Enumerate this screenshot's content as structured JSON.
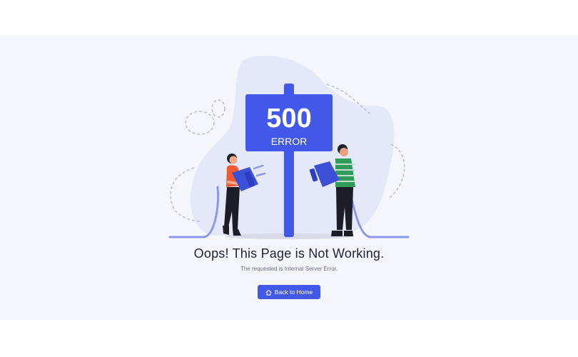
{
  "error_page": {
    "sign_code": "500",
    "sign_word": "ERROR",
    "title": "Oops! This Page is Not Working.",
    "subtitle": "The requested is Internal Server Error.",
    "home_button_label": "Back to Home",
    "home_button_icon": "home-icon"
  },
  "colors": {
    "accent": "#4158e8",
    "background": "#f4f6fb",
    "blob": "#e5e8f8",
    "title_text": "#1f2235",
    "muted_text": "#6b6f80"
  }
}
